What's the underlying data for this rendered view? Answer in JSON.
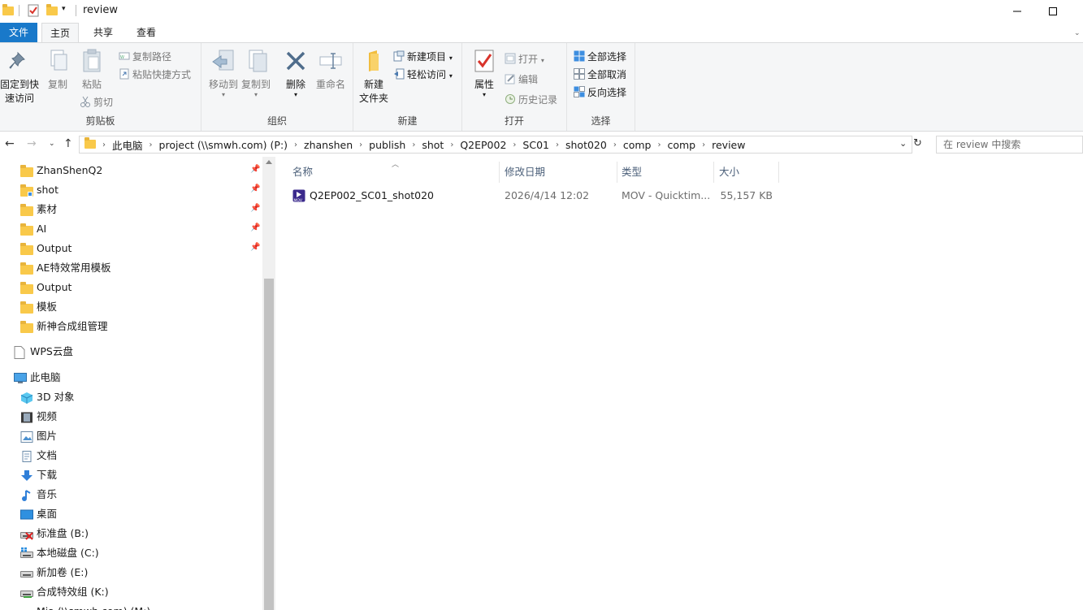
{
  "window": {
    "title": "review"
  },
  "tabs": {
    "file": "文件",
    "home": "主页",
    "share": "共享",
    "view": "查看"
  },
  "ribbon": {
    "clipboard": {
      "pin": "固定到快\n速访问",
      "pin_l1": "固定到快",
      "pin_l2": "速访问",
      "copy": "复制",
      "paste": "粘贴",
      "copy_path": "复制路径",
      "paste_shortcut": "粘贴快捷方式",
      "cut": "剪切",
      "label": "剪贴板"
    },
    "organize": {
      "move_to": "移动到",
      "copy_to": "复制到",
      "delete": "删除",
      "rename": "重命名",
      "label": "组织"
    },
    "new": {
      "new_folder_l1": "新建",
      "new_folder_l2": "文件夹",
      "new_item": "新建项目",
      "easy_access": "轻松访问",
      "label": "新建"
    },
    "open": {
      "properties": "属性",
      "open": "打开",
      "edit": "编辑",
      "history": "历史记录",
      "label": "打开"
    },
    "select": {
      "select_all": "全部选择",
      "select_none": "全部取消",
      "invert": "反向选择",
      "label": "选择"
    }
  },
  "address": {
    "crumbs": [
      "此电脑",
      "project (\\\\smwh.com) (P:)",
      "zhanshen",
      "publish",
      "shot",
      "Q2EP002",
      "SC01",
      "shot020",
      "comp",
      "comp",
      "review"
    ]
  },
  "search": {
    "placeholder": "在 review 中搜索"
  },
  "nav": {
    "quick": [
      {
        "label": "ZhanShenQ2",
        "pinned": true
      },
      {
        "label": "shot",
        "pinned": true
      },
      {
        "label": "素材",
        "pinned": true
      },
      {
        "label": "AI",
        "pinned": true
      },
      {
        "label": "Output",
        "pinned": true
      },
      {
        "label": "AE特效常用模板",
        "pinned": false
      },
      {
        "label": "Output",
        "pinned": false
      },
      {
        "label": "模板",
        "pinned": false
      },
      {
        "label": "新神合成组管理",
        "pinned": false
      }
    ],
    "wps": "WPS云盘",
    "this_pc": "此电脑",
    "pc_items": [
      "3D 对象",
      "视频",
      "图片",
      "文档",
      "下载",
      "音乐",
      "桌面",
      "标准盘 (B:)",
      "本地磁盘 (C:)",
      "新加卷 (E:)",
      "合成特效组 (K:)",
      "Mia (\\\\smwh.com) (M:)"
    ]
  },
  "columns": {
    "name": "名称",
    "date": "修改日期",
    "type": "类型",
    "size": "大小"
  },
  "files": [
    {
      "name": "Q2EP002_SC01_shot020",
      "date": "2026/4/14 12:02",
      "type": "MOV - Quicktim...",
      "size": "55,157 KB",
      "icon": "mov-file-icon"
    }
  ]
}
